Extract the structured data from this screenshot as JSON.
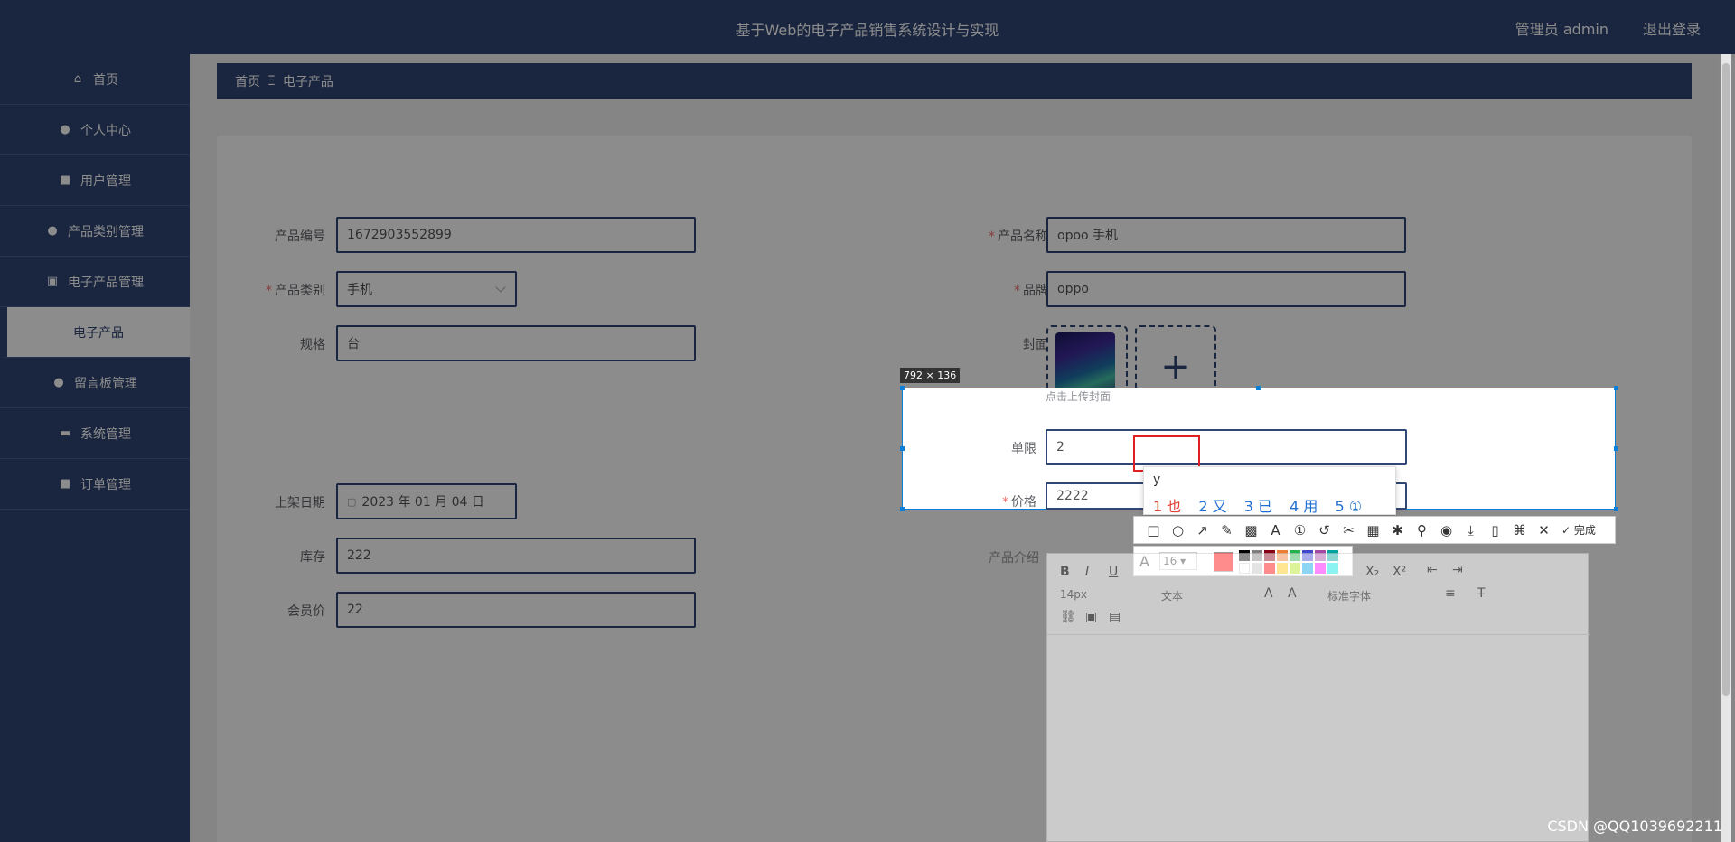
{
  "header": {
    "title": "基于Web的电子产品销售系统设计与实现",
    "user": "管理员 admin",
    "logout": "退出登录"
  },
  "sidebar": {
    "items": [
      {
        "label": "首页",
        "icon": "home-icon",
        "glyph": "⌂"
      },
      {
        "label": "个人中心",
        "icon": "user-icon",
        "glyph": "●"
      },
      {
        "label": "用户管理",
        "icon": "grid-icon",
        "glyph": "■"
      },
      {
        "label": "产品类别管理",
        "icon": "user-icon",
        "glyph": "●"
      },
      {
        "label": "电子产品管理",
        "icon": "clipboard-icon",
        "glyph": "▣"
      },
      {
        "label": "电子产品",
        "sub": true
      },
      {
        "label": "留言板管理",
        "icon": "user-icon",
        "glyph": "●"
      },
      {
        "label": "系统管理",
        "icon": "briefcase-icon",
        "glyph": "▬"
      },
      {
        "label": "订单管理",
        "icon": "grid-icon",
        "glyph": "■"
      }
    ]
  },
  "breadcrumb": {
    "home": "首页",
    "sep": "Ξ",
    "current": "电子产品"
  },
  "form": {
    "product_no": {
      "label": "产品编号",
      "value": "1672903552899"
    },
    "product_name": {
      "label": "产品名称",
      "value": "opoo 手机"
    },
    "category": {
      "label": "产品类别",
      "value": "手机"
    },
    "brand": {
      "label": "品牌",
      "value": "oppo"
    },
    "spec": {
      "label": "规格",
      "value": "台"
    },
    "cover": {
      "label": "封面",
      "hint": "点击上传封面"
    },
    "shelf_date": {
      "label": "上架日期",
      "value": "2023 年 01 月 04 日"
    },
    "limit": {
      "label": "单限",
      "value": "2"
    },
    "stock": {
      "label": "库存",
      "value": "222"
    },
    "price": {
      "label": "价格",
      "value": "2222"
    },
    "member_price": {
      "label": "会员价",
      "value": "22"
    },
    "intro": {
      "label": "产品介绍"
    }
  },
  "editor": {
    "font_size": "14px",
    "text_type": "文本",
    "font_family": "标准字体"
  },
  "screenshot_tool": {
    "size": "792 × 136",
    "done": "完成",
    "pen_size": "16"
  },
  "ime": {
    "composition": "y",
    "candidates": [
      "1 也",
      "2 又",
      "3 已",
      "4 用",
      "5 ①"
    ]
  },
  "colors": {
    "primary": "#304674",
    "required": "#f56c6c",
    "selection": "#0a7fd9"
  },
  "watermark": "CSDN @QQ1039692211"
}
